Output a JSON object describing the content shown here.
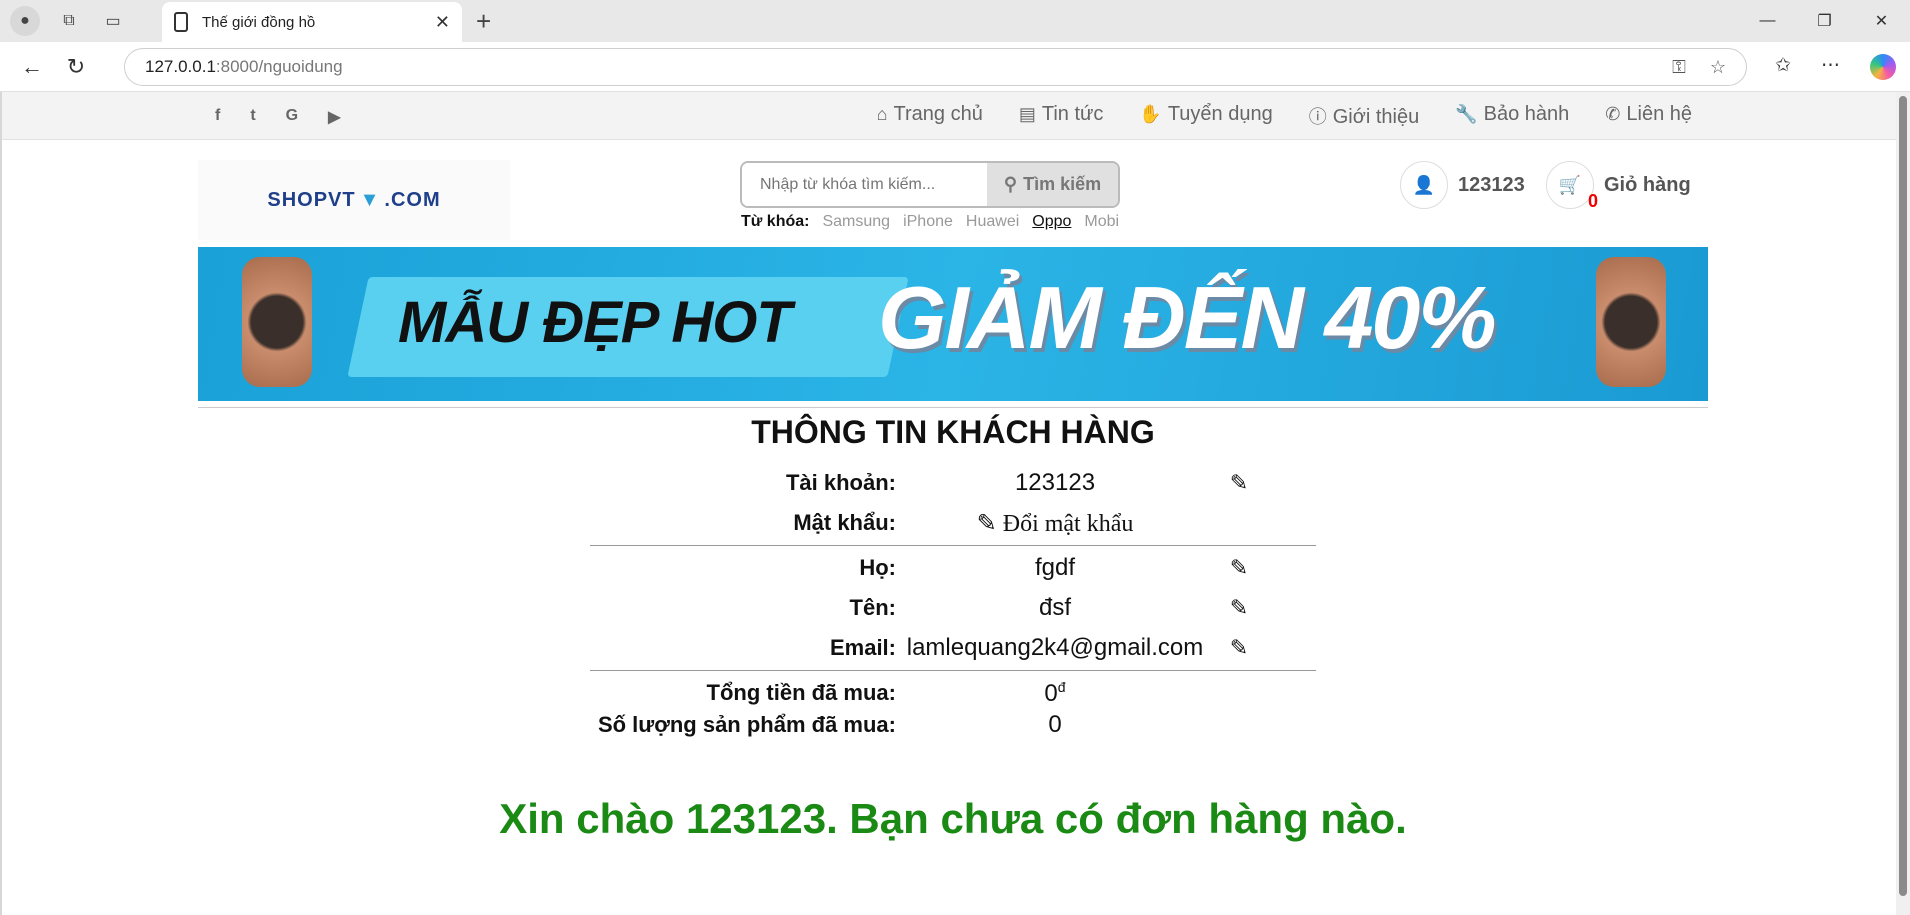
{
  "browser": {
    "tab_title": "Thế giới đồng hồ",
    "url_host": "127.0.0.1",
    "url_path": ":8000/nguoidung"
  },
  "topnav": {
    "social": [
      "f",
      "t",
      "G",
      "▶"
    ],
    "menu": [
      {
        "icon": "home-icon",
        "label": "Trang chủ"
      },
      {
        "icon": "newspaper-icon",
        "label": "Tin tức"
      },
      {
        "icon": "handshake-icon",
        "label": "Tuyển dụng"
      },
      {
        "icon": "info-circle-icon",
        "label": "Giới thiệu"
      },
      {
        "icon": "wrench-icon",
        "label": "Bảo hành"
      },
      {
        "icon": "phone-icon",
        "label": "Liên hệ"
      }
    ]
  },
  "header": {
    "logo_part1": "SHOPVT",
    "logo_part2": ".COM",
    "search_placeholder": "Nhập từ khóa tìm kiếm...",
    "search_button": "Tìm kiếm",
    "keywords_label": "Từ khóa:",
    "keywords": [
      "Samsung",
      "iPhone",
      "Huawei",
      "Oppo",
      "Mobi"
    ],
    "user_label": "123123",
    "cart_label": "Giỏ hàng",
    "cart_count": "0"
  },
  "banner": {
    "text1": "MẪU ĐẸP HOT",
    "text2": "GIẢM ĐẾN 40%"
  },
  "customer": {
    "title": "THÔNG TIN KHÁCH HÀNG",
    "account_label": "Tài khoản:",
    "account_value": "123123",
    "password_label": "Mật khẩu:",
    "password_action": "Đổi mật khẩu",
    "lastname_label": "Họ:",
    "lastname_value": "fgdf",
    "firstname_label": "Tên:",
    "firstname_value": "đsf",
    "email_label": "Email:",
    "email_value": "lamlequang2k4@gmail.com",
    "total_label": "Tổng tiền đã mua:",
    "total_value": "0",
    "total_currency": "đ",
    "qty_label": "Số lượng sản phẩm đã mua:",
    "qty_value": "0"
  },
  "greeting": "Xin chào 123123. Bạn chưa có đơn hàng nào."
}
